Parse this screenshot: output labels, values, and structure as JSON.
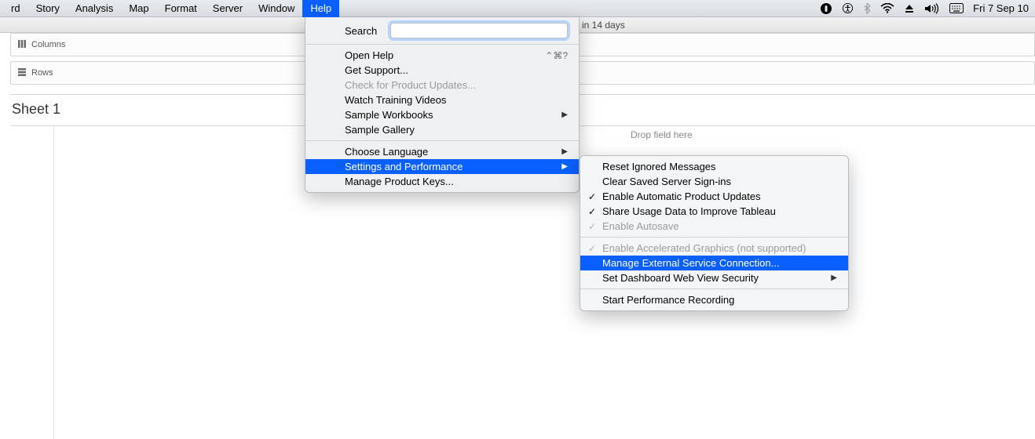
{
  "menubar": {
    "items": [
      "rd",
      "Story",
      "Analysis",
      "Map",
      "Format",
      "Server",
      "Window",
      "Help"
    ],
    "activeIndex": 7,
    "date": "Fri 7 Sep  10"
  },
  "infobar": {
    "trial": "in 14 days"
  },
  "shelves": {
    "columns": "Columns",
    "rows": "Rows"
  },
  "sheet": {
    "title": "Sheet 1",
    "dropHint": "Drop field here"
  },
  "help": {
    "searchLabel": "Search",
    "searchValue": "",
    "items": [
      {
        "label": "Open Help",
        "shortcut": "⌃⌘?"
      },
      {
        "label": "Get Support..."
      },
      {
        "label": "Check for Product Updates...",
        "disabled": true
      },
      {
        "label": "Watch Training Videos"
      },
      {
        "label": "Sample Workbooks",
        "arrow": true
      },
      {
        "label": "Sample Gallery"
      },
      {
        "sep": true
      },
      {
        "label": "Choose Language",
        "arrow": true
      },
      {
        "label": "Settings and Performance",
        "arrow": true,
        "highlight": true
      },
      {
        "label": "Manage Product Keys..."
      }
    ]
  },
  "submenu": {
    "items": [
      {
        "label": "Reset Ignored Messages"
      },
      {
        "label": "Clear Saved Server Sign-ins"
      },
      {
        "label": "Enable Automatic Product Updates",
        "check": true
      },
      {
        "label": "Share Usage Data to Improve Tableau",
        "check": true
      },
      {
        "label": "Enable Autosave",
        "check": true,
        "disabled": true
      },
      {
        "sep": true
      },
      {
        "label": "Enable Accelerated Graphics (not supported)",
        "check": true,
        "disabled": true
      },
      {
        "label": "Manage External Service Connection...",
        "highlight": true
      },
      {
        "label": "Set Dashboard Web View Security",
        "arrow": true
      },
      {
        "sep": true
      },
      {
        "label": "Start Performance Recording"
      }
    ]
  }
}
